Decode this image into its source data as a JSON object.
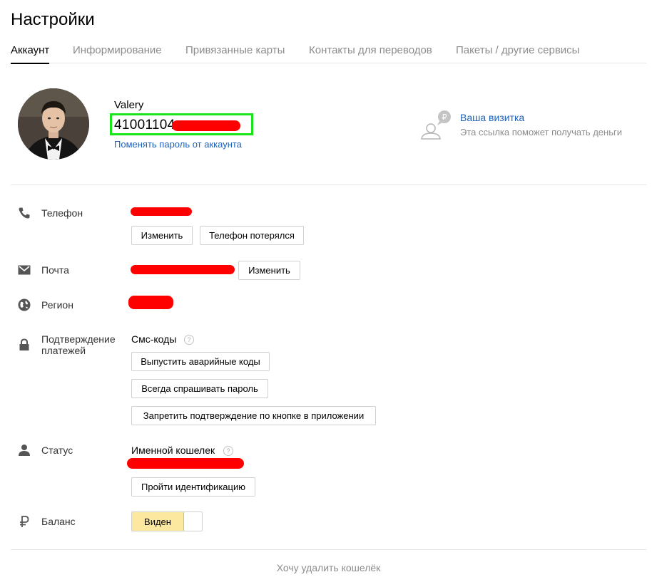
{
  "page_title": "Настройки",
  "tabs": [
    {
      "label": "Аккаунт",
      "active": true
    },
    {
      "label": "Информирование",
      "active": false
    },
    {
      "label": "Привязанные карты",
      "active": false
    },
    {
      "label": "Контакты для переводов",
      "active": false
    },
    {
      "label": "Пакеты / другие сервисы",
      "active": false
    }
  ],
  "profile": {
    "name": "Valery",
    "account_number_visible": "41001104",
    "change_password_link": "Поменять пароль от аккаунта"
  },
  "business_card": {
    "link": "Ваша визитка",
    "hint": "Эта ссылка поможет получать деньги",
    "icon": "ruble-speech-person-icon"
  },
  "phone": {
    "label": "Телефон",
    "change_button": "Изменить",
    "lost_button": "Телефон потерялся"
  },
  "email": {
    "label": "Почта",
    "change_button": "Изменить"
  },
  "region": {
    "label": "Регион"
  },
  "payment_confirmation": {
    "label": "Подтверждение платежей",
    "sms_label": "Смс-коды",
    "help": "?",
    "buttons": [
      "Выпустить аварийные коды",
      "Всегда спрашивать пароль",
      "Запретить подтверждение по кнопке в приложении"
    ]
  },
  "status": {
    "label": "Статус",
    "value": "Именной кошелек",
    "help": "?",
    "identify_button": "Пройти идентификацию"
  },
  "balance": {
    "label": "Баланс",
    "toggle_label": "Виден",
    "visible": true
  },
  "delete_link": "Хочу удалить кошелёк",
  "colors": {
    "link": "#1c62b9",
    "highlight_box": "#19e619",
    "redaction": "#ff0000",
    "toggle_active": "#fde8a0",
    "muted": "#8c8c8c"
  }
}
